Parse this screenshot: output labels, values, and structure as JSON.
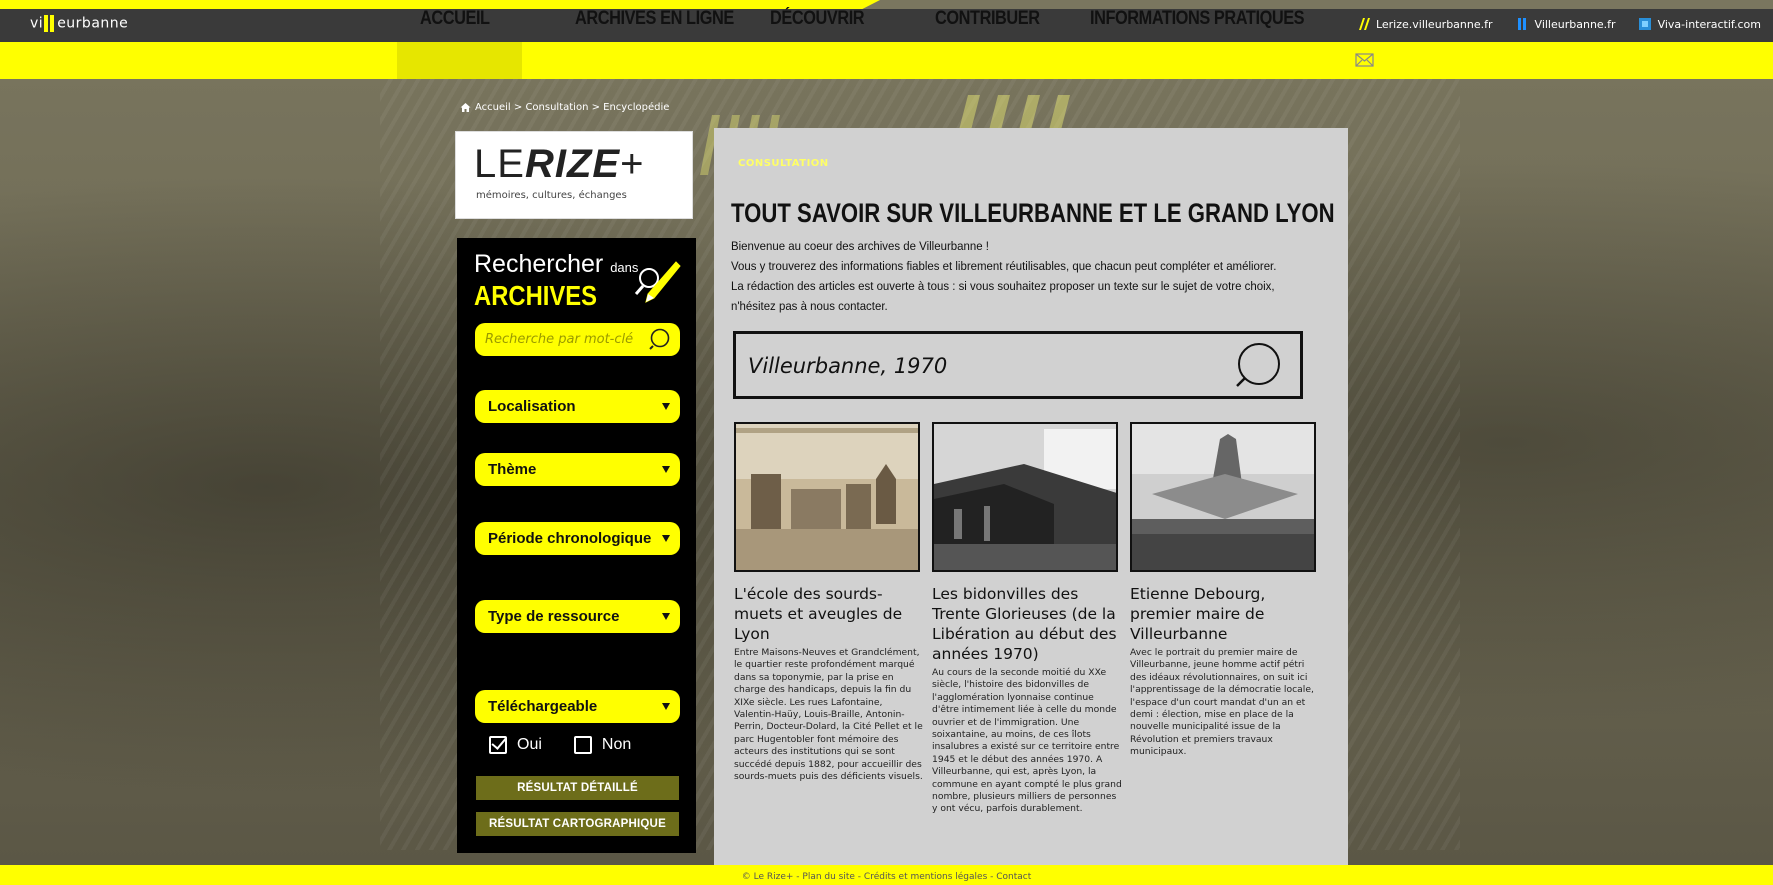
{
  "site": {
    "logo": "vi  eurbanne",
    "logo_left": "vi",
    "logo_right": "eurbanne"
  },
  "toplinks": [
    {
      "label": "Lerize.villeurbanne.fr",
      "icon": "double-slash-icon"
    },
    {
      "label": "Villeurbanne.fr",
      "icon": "bars-icon"
    },
    {
      "label": "Viva-interactif.com",
      "icon": "square-icon"
    }
  ],
  "nav": {
    "items": [
      "ACCUEIL",
      "ARCHIVES EN LIGNE",
      "DÉCOUVRIR",
      "CONTRIBUER",
      "INFORMATIONS PRATIQUES"
    ],
    "active": "ACCUEIL"
  },
  "breadcrumb": "Accueil > Consultation > Encyclopédie",
  "rize": {
    "title_light": "LE",
    "title_bold": "RIZE",
    "title_plus": "+",
    "subtitle": "mémoires, cultures, échanges"
  },
  "search_panel": {
    "title_line1": "Rechercher",
    "title_small": "dans",
    "title_line2": "ARCHIVES",
    "keyword_placeholder": "Recherche par mot-clé",
    "dropdowns": [
      "Localisation",
      "Thème",
      "Période chronologique",
      "Type de ressource",
      "Téléchargeable"
    ],
    "checkbox_yes": "Oui",
    "checkbox_no": "Non",
    "button_detail": "RÉSULTAT DÉTAILLÉ",
    "button_map": "RÉSULTAT CARTOGRAPHIQUE"
  },
  "main": {
    "tag": "CONSULTATION",
    "title": "TOUT SAVOIR SUR VILLEURBANNE ET LE GRAND LYON",
    "intro_1": "Bienvenue au coeur des archives de Villeurbanne !",
    "intro_2": "Vous y trouverez des informations fiables et librement réutilisables, que chacun peut compléter et améliorer.",
    "intro_3": "La rédaction des articles est ouverte à tous : si vous souhaitez proposer un texte sur le sujet de votre choix, n'hésitez pas à nous contacter.",
    "search_value": "Villeurbanne, 1970"
  },
  "cards": [
    {
      "title": "L'école des sourds-muets et aveugles de Lyon",
      "text": "Entre Maisons-Neuves et Grandclément, le quartier reste profondément marqué dans sa toponymie, par la prise en charge des handicaps, depuis la fin du XIXe siècle. Les rues Lafontaine, Valentin-Haüy, Louis-Braille, Antonin-Perrin, Docteur-Dolard, la Cité Pellet et le parc Hugentobler font mémoire des acteurs des institutions qui se sont succédé depuis 1882, pour accueillir des sourds-muets puis des déficients visuels."
    },
    {
      "title": "Les bidonvilles des Trente Glorieuses (de la Libération au début des années 1970)",
      "text": "Au cours de la seconde moitié du XXe siècle, l'histoire des bidonvilles de l'agglomération lyonnaise continue d'être intimement liée à celle du monde ouvrier et de l'immigration. Une soixantaine, au moins, de ces îlots insalubres a existé sur ce territoire entre 1945 et le début des années 1970. A Villeurbanne, qui est, après Lyon, la commune en ayant compté le plus grand nombre, plusieurs milliers de personnes y ont vécu, parfois durablement."
    },
    {
      "title": "Etienne Debourg, premier maire de Villeurbanne",
      "text": "Avec le portrait du premier maire de Villeurbanne, jeune homme actif pétri des idéaux révolutionnaires, on suit ici l'apprentissage de la démocratie locale, l'espace d'un court mandat d'un an et demi : élection, mise en place de la nouvelle municipalité issue de la Révolution et premiers travaux municipaux."
    }
  ],
  "footer": {
    "copyright": "© Le Rize+",
    "links": [
      "Plan du site",
      "Crédits et mentions légales",
      "Contact"
    ]
  },
  "colors": {
    "accent": "#ffff00",
    "panel": "#000000",
    "content_bg": "#d1d1d1",
    "topbar": "#3a3a3a"
  }
}
